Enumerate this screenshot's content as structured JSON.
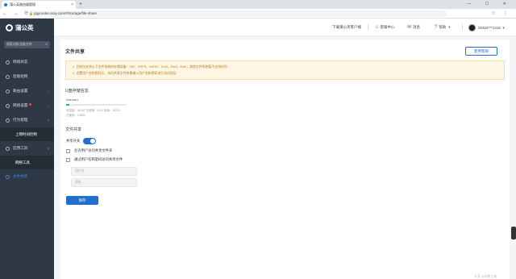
{
  "browser": {
    "tab_title": "蒲公英路由器管理",
    "url": "pgyrouter.oray.com/#/storage/file-share",
    "lock_icon": "lock-icon",
    "win_controls": "— ☐ ✕"
  },
  "sidebar": {
    "brand": "蒲公英",
    "search_placeholder": "搜索功能/设备名称",
    "items": [
      {
        "label": "网络状态"
      },
      {
        "label": "智能组网"
      },
      {
        "label": "路由设置"
      },
      {
        "label": "网络设置"
      },
      {
        "label": "行为管理"
      },
      {
        "label": "上网时间控制"
      },
      {
        "label": "应用工具"
      },
      {
        "label": "网络工具"
      },
      {
        "label": "文件共享"
      }
    ]
  },
  "topbar": {
    "download": "下载蒲公英客户端",
    "service": "客服中心",
    "devices": "消息",
    "help": "帮助",
    "account": "25462***1418"
  },
  "page": {
    "title": "文件共享",
    "help_button": "使用帮助",
    "notice": [
      "1. 目前仅支持以下文件系统的存储设备：FAT、NTFS、exFAT、Ext2、Ext3、Ext4，其他文件系统暂不支持访问",
      "2. 设置用户名和密码后，访问共享文件时需输入用户名和密码进行访问验证"
    ],
    "storage_section": "U盘存储信息",
    "volume": "Volume1",
    "storage_meta": "总容量：58.6G  已使用：0.4G  剩余：58.2G",
    "storage_used": "已使用：2.86%",
    "share_section": "文件共享",
    "toggle_label": "共享开关",
    "option1": "允许用户访问共享文件夹",
    "option2": "通过用户名和密码访问共享文件",
    "username_placeholder": "用户名",
    "password_placeholder": "密码",
    "save": "保存",
    "watermark": "头条 @网络工具"
  },
  "storage_used_fraction": 0.05
}
